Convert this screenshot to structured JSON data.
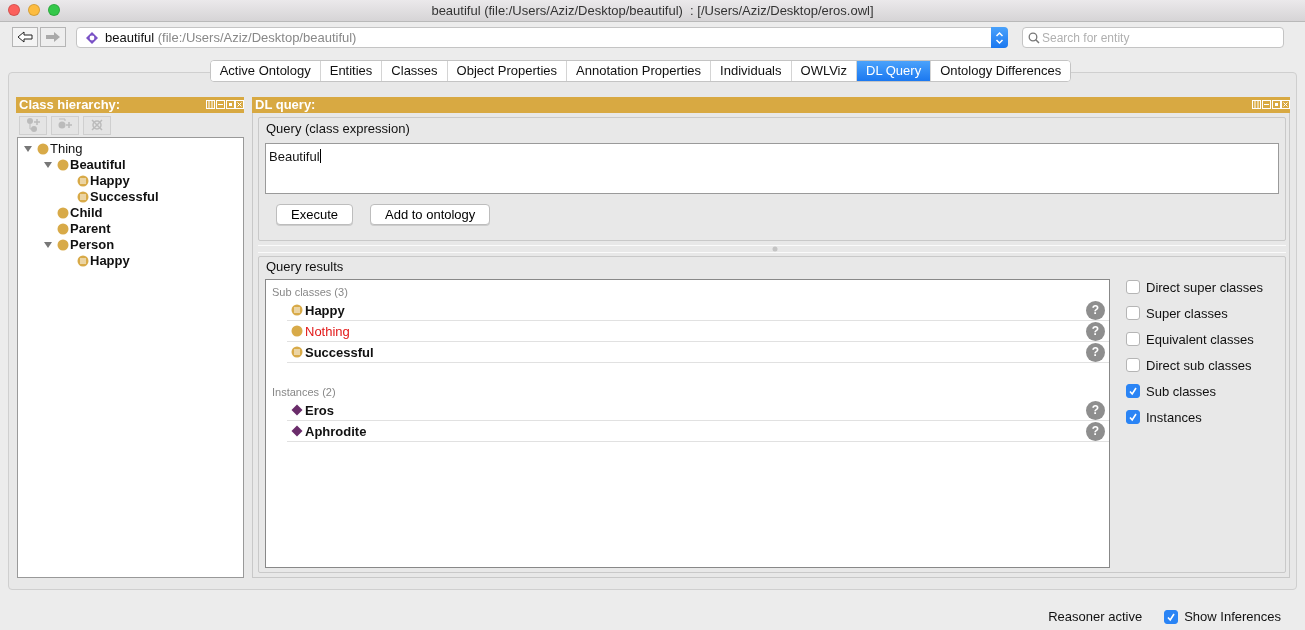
{
  "window": {
    "title": "beautiful (file:/Users/Aziz/Desktop/beautiful)  : [/Users/Aziz/Desktop/eros.owl]"
  },
  "toolbar": {
    "ontology_name": "beautiful",
    "ontology_iri": "(file:/Users/Aziz/Desktop/beautiful)",
    "search": {
      "placeholder": "Search for entity"
    }
  },
  "tabs": [
    {
      "label": "Active Ontology",
      "selected": false
    },
    {
      "label": "Entities",
      "selected": false
    },
    {
      "label": "Classes",
      "selected": false
    },
    {
      "label": "Object Properties",
      "selected": false
    },
    {
      "label": "Annotation Properties",
      "selected": false
    },
    {
      "label": "Individuals",
      "selected": false
    },
    {
      "label": "OWLViz",
      "selected": false
    },
    {
      "label": "DL Query",
      "selected": true
    },
    {
      "label": "Ontology Differences",
      "selected": false
    }
  ],
  "class_hierarchy": {
    "title": "Class hierarchy:",
    "tree": [
      {
        "label": "Thing",
        "kind": "class",
        "bold": false,
        "expanded": true,
        "children": [
          {
            "label": "Beautiful",
            "kind": "class",
            "bold": true,
            "expanded": true,
            "children": [
              {
                "label": "Happy",
                "kind": "defined",
                "bold": true
              },
              {
                "label": "Successful",
                "kind": "defined",
                "bold": true
              }
            ]
          },
          {
            "label": "Child",
            "kind": "class",
            "bold": true
          },
          {
            "label": "Parent",
            "kind": "class",
            "bold": true
          },
          {
            "label": "Person",
            "kind": "class",
            "bold": true,
            "expanded": true,
            "children": [
              {
                "label": "Happy",
                "kind": "defined",
                "bold": true
              }
            ]
          }
        ]
      }
    ]
  },
  "dl_query": {
    "title": "DL query:",
    "query_section": "Query (class expression)",
    "query_text": "Beautiful",
    "buttons": [
      "Execute",
      "Add to ontology"
    ],
    "results_section": "Query results",
    "groups": [
      {
        "title": "Sub classes (3)",
        "items": [
          {
            "label": "Happy",
            "kind": "defined",
            "error": false,
            "help": "?"
          },
          {
            "label": "Nothing",
            "kind": "class",
            "error": true,
            "help": "?"
          },
          {
            "label": "Successful",
            "kind": "defined",
            "error": false,
            "help": "?"
          }
        ]
      },
      {
        "title": "Instances (2)",
        "items": [
          {
            "label": "Eros",
            "kind": "individual",
            "error": false,
            "help": "?"
          },
          {
            "label": "Aphrodite",
            "kind": "individual",
            "error": false,
            "help": "?"
          }
        ]
      }
    ],
    "options": [
      {
        "label": "Direct super classes",
        "checked": false
      },
      {
        "label": "Super classes",
        "checked": false
      },
      {
        "label": "Equivalent classes",
        "checked": false
      },
      {
        "label": "Direct sub classes",
        "checked": false
      },
      {
        "label": "Sub classes",
        "checked": true
      },
      {
        "label": "Instances",
        "checked": true
      }
    ]
  },
  "status_bar": {
    "reasoner": "Reasoner active",
    "show_inferences": {
      "label": "Show Inferences",
      "checked": true
    }
  }
}
